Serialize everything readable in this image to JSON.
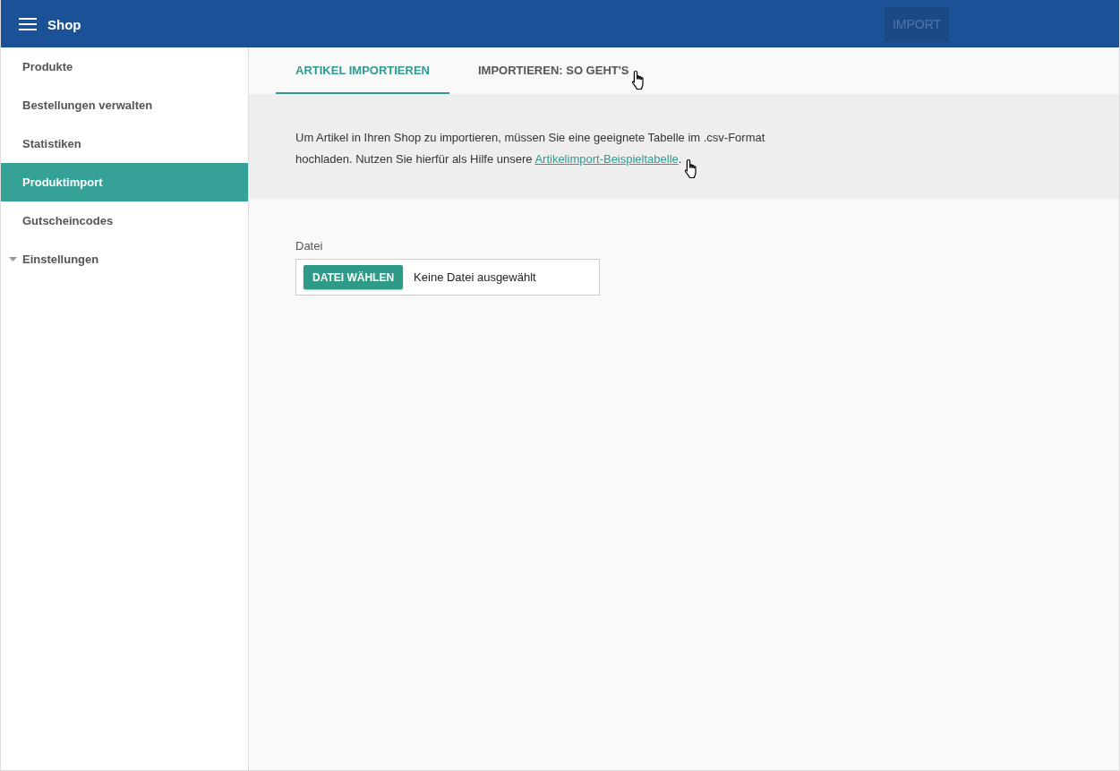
{
  "header": {
    "title": "Shop",
    "import_button": {
      "label": "IMPORT",
      "disabled": true
    }
  },
  "sidebar": {
    "items": [
      {
        "label": "Produkte",
        "selected": false,
        "kind": "item"
      },
      {
        "label": "Bestellungen verwalten",
        "selected": false,
        "kind": "item"
      },
      {
        "label": "Statistiken",
        "selected": false,
        "kind": "item"
      },
      {
        "label": "Produktimport",
        "selected": true,
        "kind": "item"
      },
      {
        "label": "Gutscheincodes",
        "selected": false,
        "kind": "item"
      },
      {
        "label": "Einstellungen",
        "selected": false,
        "kind": "group"
      }
    ]
  },
  "tabs": [
    {
      "label": "ARTIKEL IMPORTIEREN",
      "selected": true,
      "hovered": false
    },
    {
      "label": "IMPORTIEREN: SO GEHT'S",
      "selected": false,
      "hovered": true
    }
  ],
  "info": {
    "text_before": "Um Artikel in Ihren Shop zu importieren, müssen Sie eine geeignete Tabelle im .csv-Format hochladen. Nutzen Sie hierfür als Hilfe unsere ",
    "link": "Artikelimport-Beispieltabelle",
    "text_after": ".",
    "link_hovered": true
  },
  "file_field": {
    "label": "Datei",
    "button": "DATEI WÄHLEN",
    "value": "Keine Datei ausgewählt"
  }
}
